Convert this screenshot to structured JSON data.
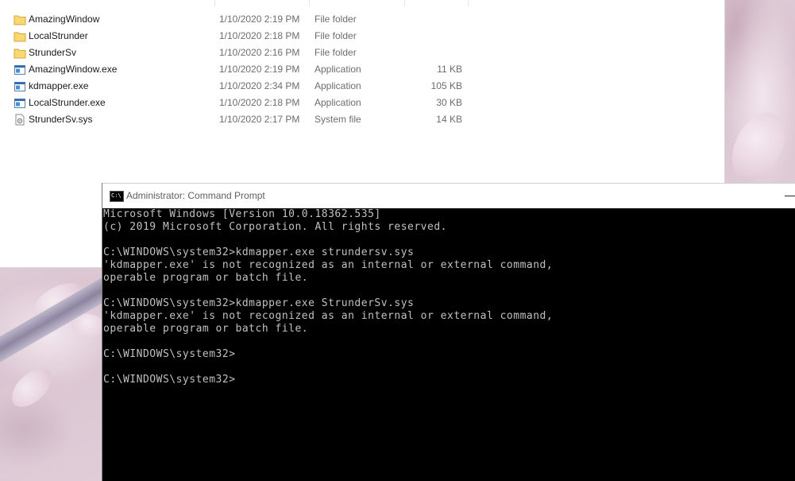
{
  "explorer": {
    "files": [
      {
        "name": "AmazingWindow",
        "date": "1/10/2020 2:19 PM",
        "type": "File folder",
        "size": "",
        "icon": "folder-icon"
      },
      {
        "name": "LocalStrunder",
        "date": "1/10/2020 2:18 PM",
        "type": "File folder",
        "size": "",
        "icon": "folder-icon"
      },
      {
        "name": "StrunderSv",
        "date": "1/10/2020 2:16 PM",
        "type": "File folder",
        "size": "",
        "icon": "folder-icon"
      },
      {
        "name": "AmazingWindow.exe",
        "date": "1/10/2020 2:19 PM",
        "type": "Application",
        "size": "11 KB",
        "icon": "application-icon"
      },
      {
        "name": "kdmapper.exe",
        "date": "1/10/2020 2:34 PM",
        "type": "Application",
        "size": "105 KB",
        "icon": "application-icon"
      },
      {
        "name": "LocalStrunder.exe",
        "date": "1/10/2020 2:18 PM",
        "type": "Application",
        "size": "30 KB",
        "icon": "application-icon"
      },
      {
        "name": "StrunderSv.sys",
        "date": "1/10/2020 2:17 PM",
        "type": "System file",
        "size": "14 KB",
        "icon": "system-file-icon"
      }
    ]
  },
  "cmd": {
    "title": "Administrator: Command Prompt",
    "icon_label": "C:\\",
    "minimize_glyph": "—",
    "lines": [
      "Microsoft Windows [Version 10.0.18362.535]",
      "(c) 2019 Microsoft Corporation. All rights reserved.",
      "",
      "C:\\WINDOWS\\system32>kdmapper.exe strundersv.sys",
      "'kdmapper.exe' is not recognized as an internal or external command,",
      "operable program or batch file.",
      "",
      "C:\\WINDOWS\\system32>kdmapper.exe StrunderSv.sys",
      "'kdmapper.exe' is not recognized as an internal or external command,",
      "operable program or batch file.",
      "",
      "C:\\WINDOWS\\system32>",
      "",
      "C:\\WINDOWS\\system32>"
    ]
  },
  "colors": {
    "folder": "#f8d775",
    "application": "#2b6cb0",
    "console_bg": "#000000",
    "console_text": "#c0c0c0"
  }
}
